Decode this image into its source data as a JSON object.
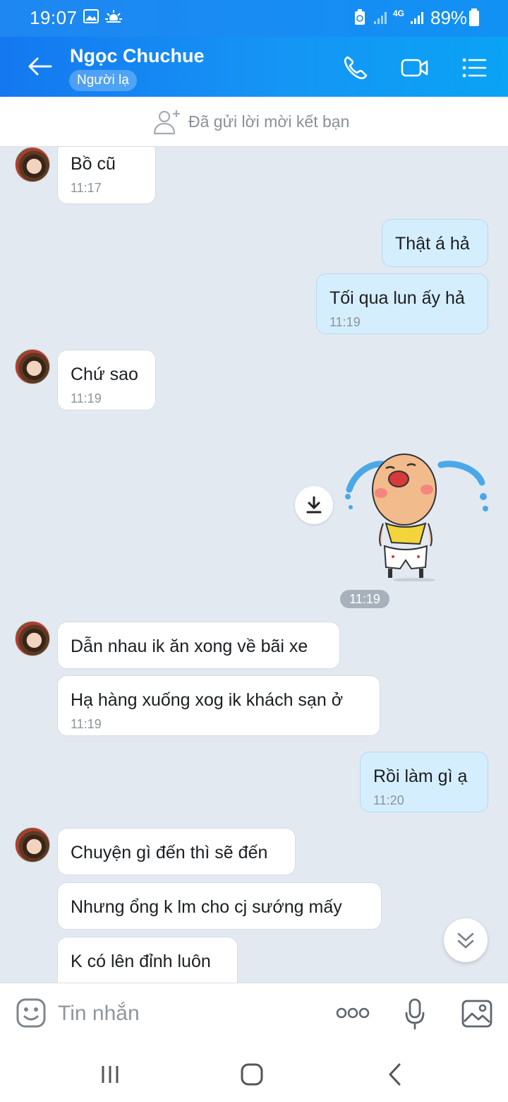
{
  "status_bar": {
    "time": "19:07",
    "network": "4G",
    "battery": "89%"
  },
  "header": {
    "contact_name": "Ngọc Chuchue",
    "badge": "Người lạ"
  },
  "friend_bar": {
    "text": "Đã gửi lời mời kết bạn"
  },
  "messages": [
    {
      "side": "recv",
      "text": "Bồ cũ",
      "time": "11:17"
    },
    {
      "side": "sent",
      "text": "Thật á hả"
    },
    {
      "side": "sent",
      "text": "Tối qua lun ấy hả",
      "time": "11:19"
    },
    {
      "side": "recv",
      "text": "Chứ sao",
      "time": "11:19"
    },
    {
      "side": "sent",
      "sticker": "crying-baby",
      "time": "11:19"
    },
    {
      "side": "recv",
      "text": "Dẫn nhau ik ăn xong về bãi xe"
    },
    {
      "side": "recv",
      "text": "Hạ hàng xuống xog ik khách sạn ở",
      "time": "11:19"
    },
    {
      "side": "sent",
      "text": "Rồi làm gì ạ",
      "time": "11:20"
    },
    {
      "side": "recv",
      "text": "Chuyện gì đến thì sẽ đến"
    },
    {
      "side": "recv",
      "text": "Nhưng ổng k lm cho cj sướng mấy"
    },
    {
      "side": "recv",
      "text": "K có lên đỉnh luôn"
    }
  ],
  "input": {
    "placeholder": "Tin nhắn"
  },
  "colors": {
    "header_blue": "#1595f5",
    "sent_bubble": "#d5eefd",
    "chat_bg": "#e2e9f1"
  }
}
